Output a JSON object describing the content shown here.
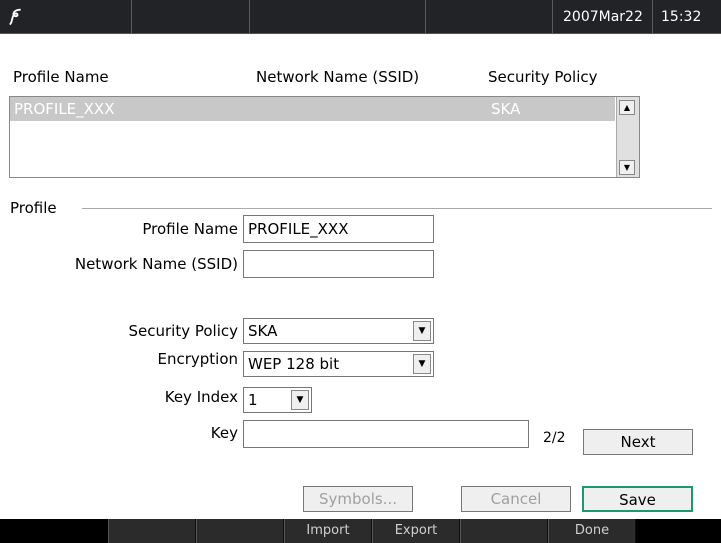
{
  "status_bar": {
    "date": "2007Mar22",
    "time": "15:32"
  },
  "profile_list": {
    "headers": [
      "Profile Name",
      "Network Name (SSID)",
      "Security Policy"
    ],
    "rows": [
      {
        "profile_name": "PROFILE_XXX",
        "ssid": "",
        "security_policy": "SKA"
      }
    ]
  },
  "profile": {
    "section_title": "Profile",
    "profile_name_label": "Profile Name",
    "profile_name_value": "PROFILE_XXX",
    "ssid_label": "Network Name (SSID)",
    "ssid_value": "",
    "security_policy_label": "Security Policy",
    "security_policy_value": "SKA",
    "encryption_label": "Encryption",
    "encryption_value": "WEP 128 bit",
    "key_index_label": "Key Index",
    "key_index_value": "1",
    "key_label": "Key",
    "key_value": "",
    "page_indicator": "2/2",
    "next_label": "Next"
  },
  "actions": {
    "symbols": "Symbols...",
    "cancel": "Cancel",
    "save": "Save"
  },
  "bottom_bar": {
    "import": "Import",
    "export": "Export",
    "done": "Done"
  },
  "colors": {
    "topbar": "#222327",
    "selection": "#c8c8c8",
    "save_border": "#1a9a6a"
  }
}
